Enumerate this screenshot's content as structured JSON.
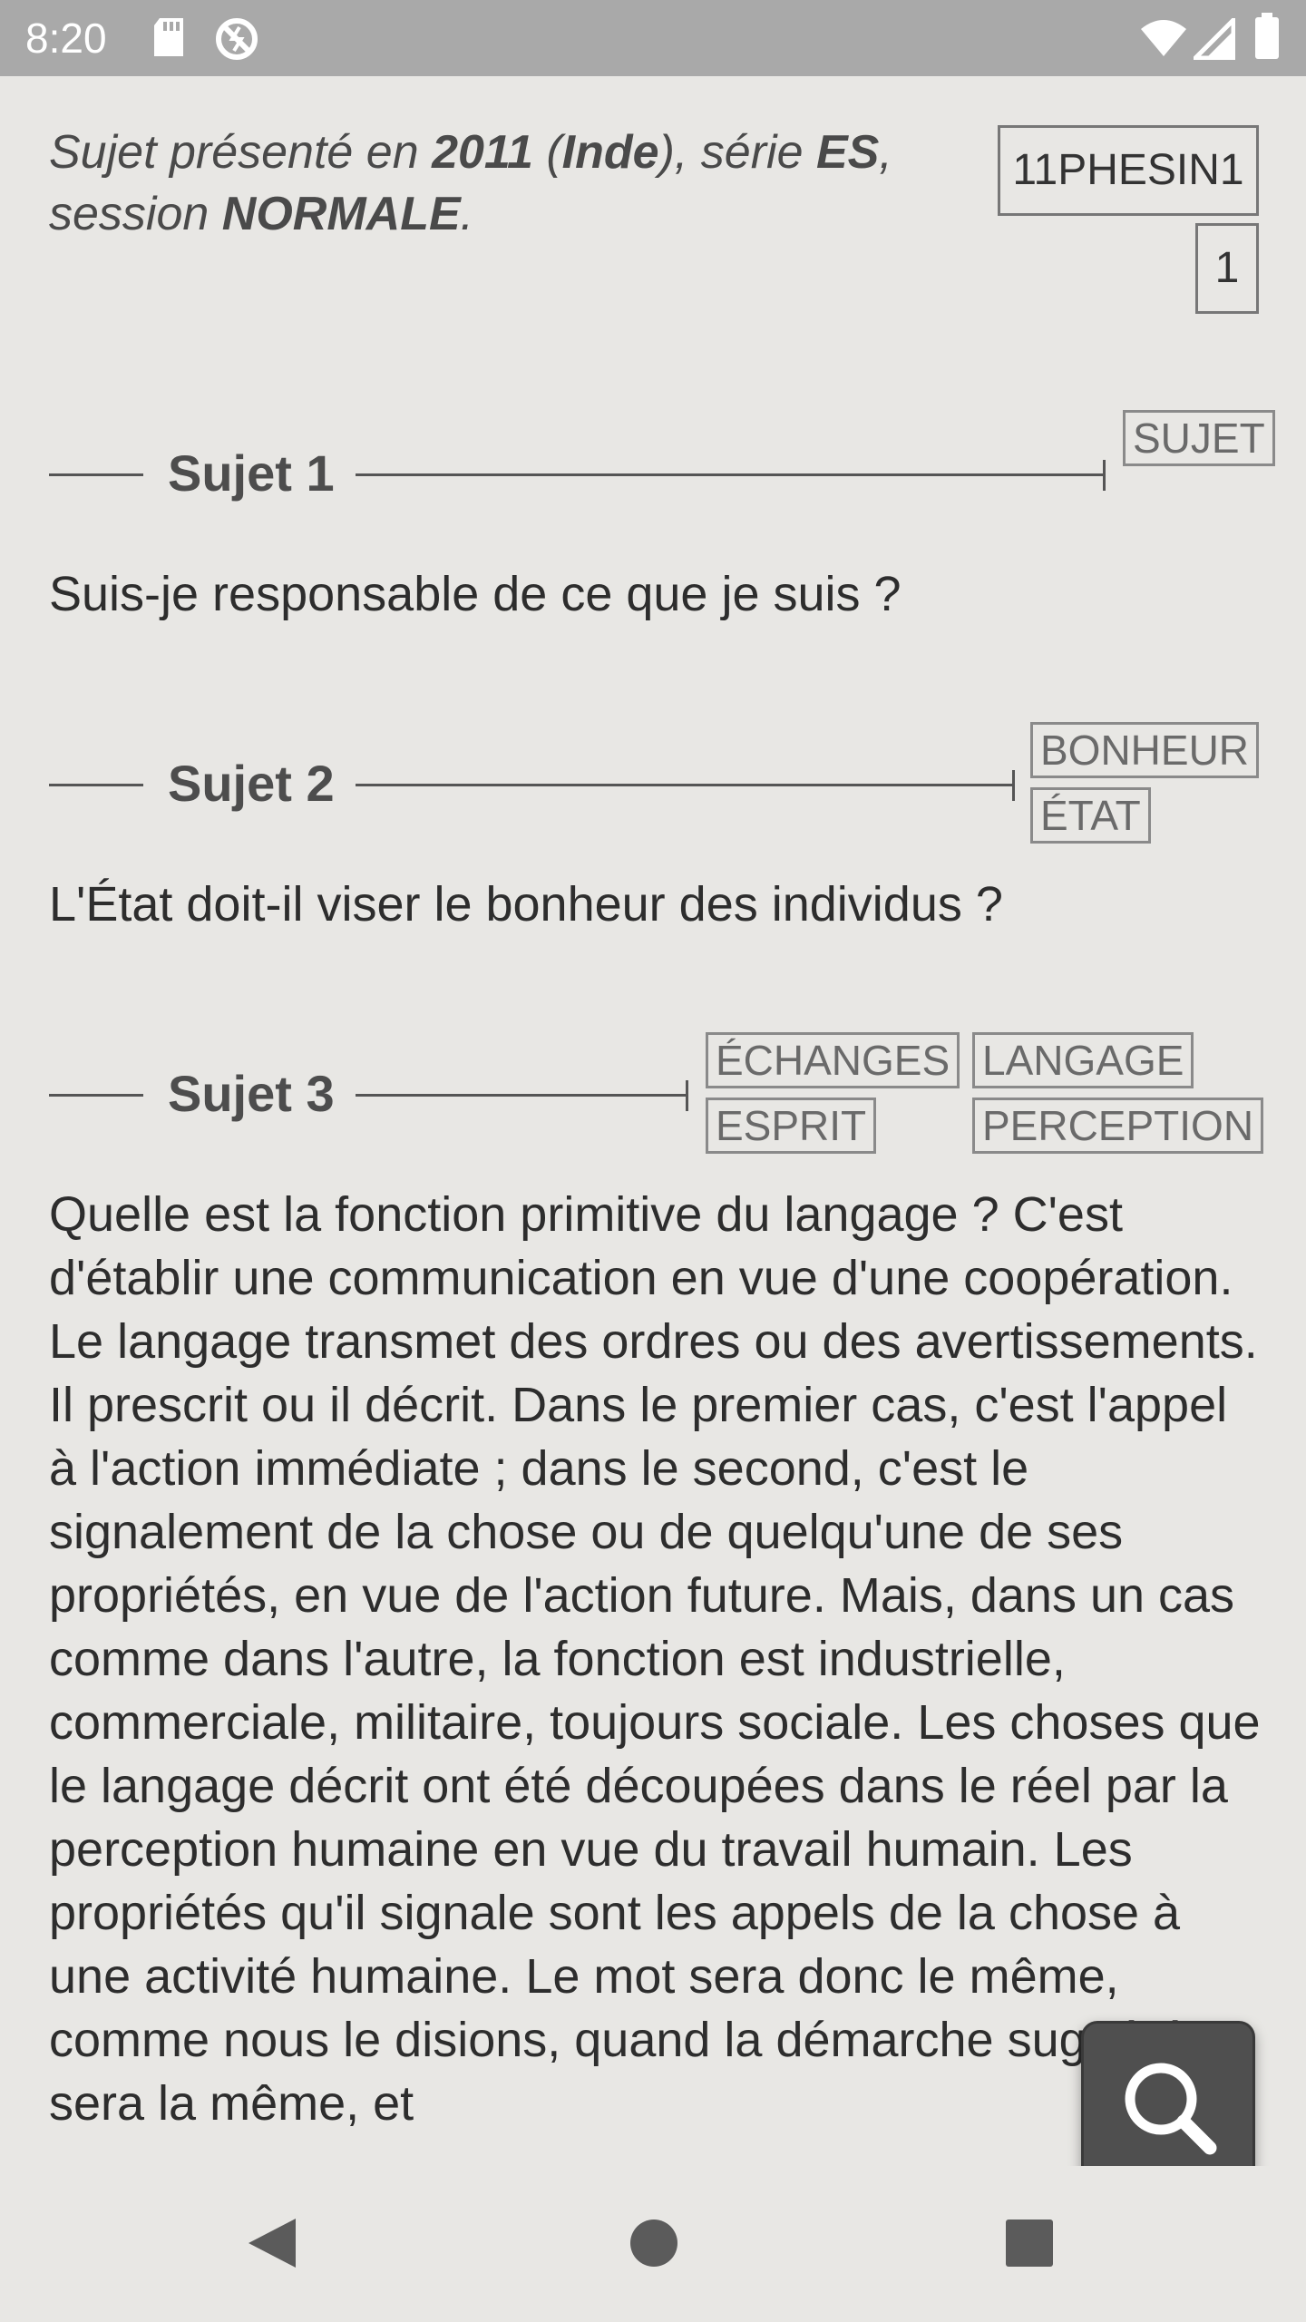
{
  "status_bar": {
    "time": "8:20",
    "icons": [
      "sd-card-icon",
      "sync-disabled-icon",
      "wifi-icon",
      "signal-icon",
      "battery-icon"
    ]
  },
  "header": {
    "intro_prefix": "Sujet présenté en ",
    "year": "2011",
    "open_paren": " (",
    "country": "Inde",
    "series_prefix": "), série ",
    "series": "ES",
    "comma": ",",
    "session_prefix": "session ",
    "session": "NORMALE",
    "period": ".",
    "code": "11PHESIN1",
    "number": "1"
  },
  "sujets": [
    {
      "title": "Sujet 1",
      "tags": [
        "SUJET"
      ],
      "question": "Suis-je responsable de ce que je suis ?"
    },
    {
      "title": "Sujet 2",
      "tags": [
        "BONHEUR",
        "ÉTAT"
      ],
      "question": "L'État doit-il viser le bonheur des individus ?"
    },
    {
      "title": "Sujet 3",
      "tags": [
        "ÉCHANGES",
        "LANGAGE",
        "ESPRIT",
        "PERCEPTION"
      ],
      "passage": "Quelle est la fonction primitive du langage ? C'est d'établir une communication en vue d'une coopération. Le langage transmet des ordres ou des avertissements. Il prescrit ou il décrit. Dans le premier cas, c'est l'appel à l'action immédiate ; dans le second, c'est le signalement de la chose ou de quelqu'une de ses propriétés, en vue de l'action future. Mais, dans un cas comme dans l'autre, la fonction est industrielle, commerciale, militaire, toujours sociale. Les choses que le langage décrit ont été découpées dans le réel par la perception humaine en vue du travail humain. Les propriétés qu'il signale sont les appels de la chose à une activité humaine. Le mot sera donc le même, comme nous le disions, quand la démarche suggérée sera la même, et"
    }
  ],
  "fab": {
    "icon": "search-icon"
  },
  "nav": {
    "icons": [
      "back-icon",
      "home-icon",
      "recents-icon"
    ]
  }
}
